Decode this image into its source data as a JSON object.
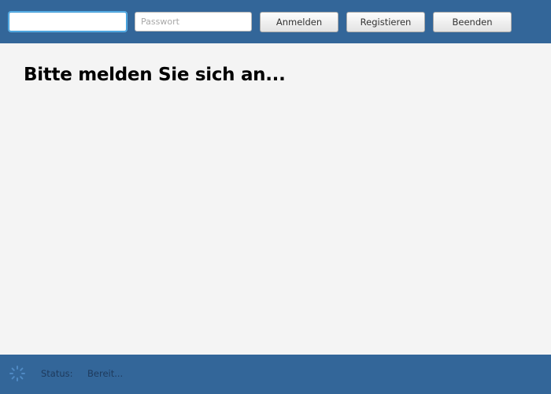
{
  "toolbar": {
    "username": {
      "value": "",
      "placeholder": ""
    },
    "password": {
      "value": "",
      "placeholder": "Passwort"
    },
    "login_label": "Anmelden",
    "register_label": "Registieren",
    "quit_label": "Beenden"
  },
  "main": {
    "heading": "Bitte melden Sie sich an..."
  },
  "statusbar": {
    "spinner_icon": "loading-spinner-icon",
    "label": "Status:",
    "value": "Bereit..."
  },
  "colors": {
    "bar_background": "#336699",
    "content_background": "#f4f4f4",
    "focus_ring": "#3a99d6"
  }
}
